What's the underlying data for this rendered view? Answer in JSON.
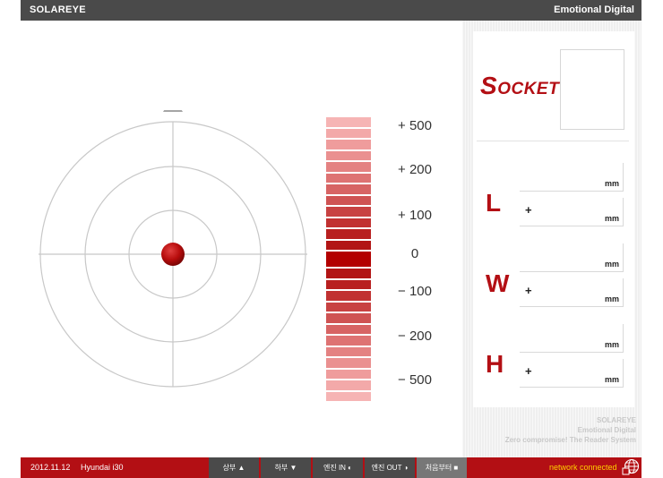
{
  "header": {
    "brand": "SOLAREYE",
    "tagline": "Emotional Digital"
  },
  "scale": {
    "labels": [
      "+ 500",
      "+ 200",
      "+ 100",
      "0",
      "− 100",
      "− 200",
      "− 500"
    ],
    "bars_above": [
      "#f6b4b4",
      "#f3a9a9",
      "#ef9c9c",
      "#ea9090",
      "#e48282",
      "#de7373",
      "#d76464",
      "#cf5353",
      "#c84242",
      "#c13131",
      "#b82020",
      "#b21515"
    ],
    "center_color": "#b30000",
    "bars_below": [
      "#b21515",
      "#b82020",
      "#c13131",
      "#c84242",
      "#cf5353",
      "#d76464",
      "#de7373",
      "#e48282",
      "#ea9090",
      "#ef9c9c",
      "#f3a9a9",
      "#f6b4b4"
    ]
  },
  "panel": {
    "socket_initial": "S",
    "socket_rest": "OCKET",
    "dimensions": [
      {
        "letter": "L",
        "unit": "mm",
        "plus": "+",
        "unit2": "mm"
      },
      {
        "letter": "W",
        "unit": "mm",
        "plus": "+",
        "unit2": "mm"
      },
      {
        "letter": "H",
        "unit": "mm",
        "plus": "+",
        "unit2": "mm"
      }
    ],
    "footnote": [
      "SOLAREYE",
      "Emotional Digital",
      "Zero compromise! The Reader System"
    ]
  },
  "footer": {
    "date": "2012.11.12",
    "car": "Hyundai  i30",
    "controls": [
      "상부 ▲",
      "하부 ▼",
      "엔진 IN ◐",
      "엔진 OUT ◑",
      "처음부터 ■"
    ],
    "status": "network connected"
  },
  "colors": {
    "accent": "#b30f14",
    "dark_bar": "#4a4a4a",
    "status_text": "#ffd000"
  }
}
